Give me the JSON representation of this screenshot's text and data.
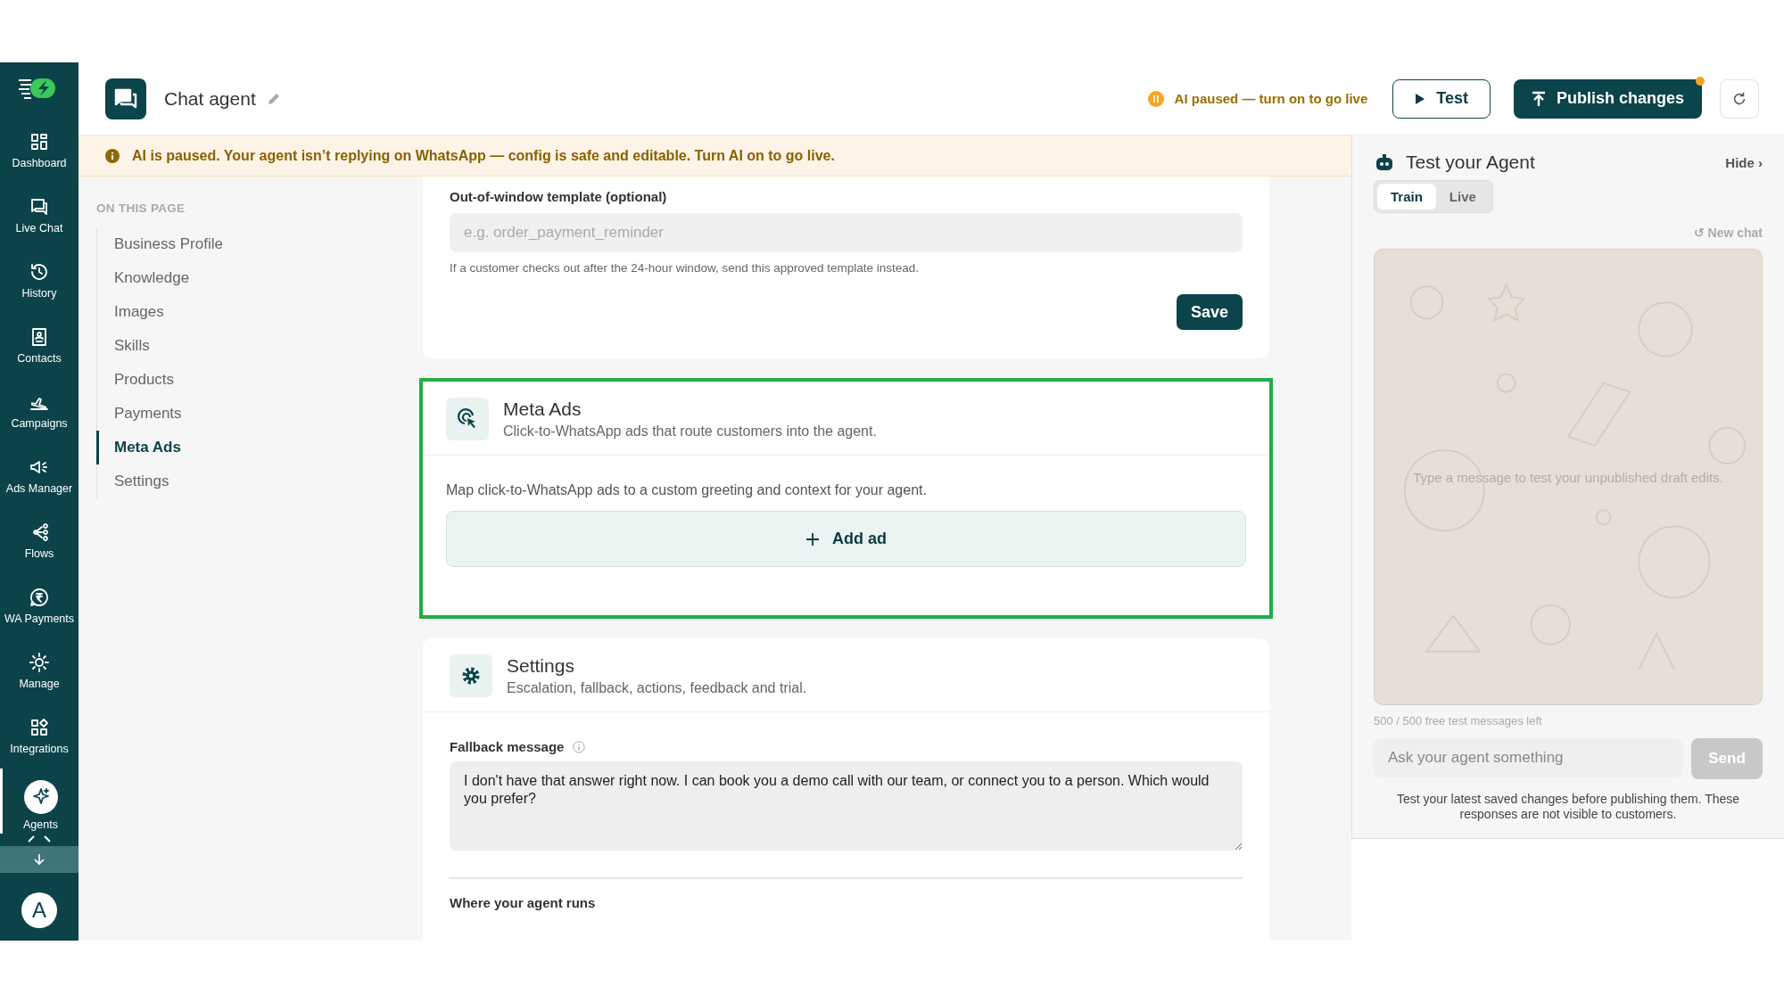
{
  "rail": {
    "items": [
      {
        "label": "Dashboard",
        "selected": false
      },
      {
        "label": "Live Chat",
        "selected": false
      },
      {
        "label": "History",
        "selected": false
      },
      {
        "label": "Contacts",
        "selected": false
      },
      {
        "label": "Campaigns",
        "selected": false
      },
      {
        "label": "Ads Manager",
        "selected": false
      },
      {
        "label": "Flows",
        "selected": false
      },
      {
        "label": "WA Payments",
        "selected": false
      },
      {
        "label": "Manage",
        "selected": false
      },
      {
        "label": "Integrations",
        "selected": false
      },
      {
        "label": "Agents",
        "selected": true
      }
    ],
    "avatar_initial": "A"
  },
  "header": {
    "title": "Chat agent",
    "status": "AI paused — turn on to go live",
    "test_button": "Test",
    "publish_button": "Publish changes",
    "unpublished": true
  },
  "banner": "AI is paused. Your agent isn’t replying on WhatsApp — config is safe and editable. Turn AI on to go live.",
  "page_nav": {
    "heading": "ON THIS PAGE",
    "items": [
      {
        "label": "Business Profile",
        "selected": false
      },
      {
        "label": "Knowledge",
        "selected": false
      },
      {
        "label": "Images",
        "selected": false
      },
      {
        "label": "Skills",
        "selected": false
      },
      {
        "label": "Products",
        "selected": false
      },
      {
        "label": "Payments",
        "selected": false
      },
      {
        "label": "Meta Ads",
        "selected": true
      },
      {
        "label": "Settings",
        "selected": false
      }
    ]
  },
  "template_card": {
    "label": "Out-of-window template (optional)",
    "placeholder": "e.g. order_payment_reminder",
    "help": "If a customer checks out after the 24-hour window, send this approved template instead.",
    "save_button": "Save"
  },
  "meta_ads_card": {
    "title": "Meta Ads",
    "subtitle": "Click-to-WhatsApp ads that route customers into the agent.",
    "highlighted": true,
    "description": "Map click-to-WhatsApp ads to a custom greeting and context for your agent.",
    "add_button": "Add ad"
  },
  "settings_card": {
    "title": "Settings",
    "subtitle": "Escalation, fallback, actions, feedback and trial.",
    "fallback_label": "Fallback message",
    "fallback_value": "I don't have that answer right now. I can book you a demo call with our team, or connect you to a person. Which would you prefer?",
    "next_section": "Where your agent runs"
  },
  "test_panel": {
    "title": "Test your Agent",
    "hide": "Hide ›",
    "modes": [
      {
        "label": "Train",
        "selected": true
      },
      {
        "label": "Live",
        "selected": false
      }
    ],
    "new_chat": "↺ New chat",
    "empty_hint": "Type a message to test your unpublished draft edits.",
    "quota": "500 / 500 free test messages left",
    "input_placeholder": "Ask your agent something",
    "send_button": "Send",
    "send_disabled": true,
    "footnote": "Test your latest saved changes before publishing them. These responses are not visible to customers."
  }
}
